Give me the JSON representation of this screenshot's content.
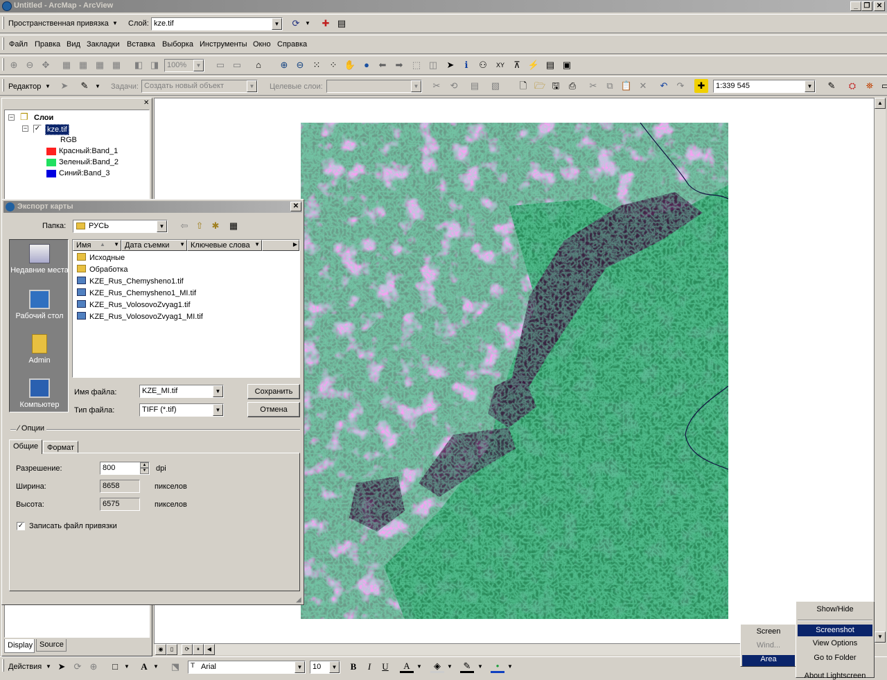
{
  "window": {
    "title": "Untitled - ArcMap - ArcView"
  },
  "georef_toolbar": {
    "label": "Пространственная привязка",
    "layer_label": "Слой:",
    "layer_value": "kze.tif"
  },
  "menu": [
    "Файл",
    "Правка",
    "Вид",
    "Закладки",
    "Вставка",
    "Выборка",
    "Инструменты",
    "Окно",
    "Справка"
  ],
  "tools_toolbar": {
    "zoom_value": "100%"
  },
  "editor_toolbar": {
    "editor_label": "Редактор",
    "task_label": "Задачи:",
    "task_value": "Создать новый объект",
    "target_label": "Целевые слои:",
    "target_value": "",
    "scale_value": "1:339 545"
  },
  "toc": {
    "root": "Слои",
    "layer": "kze.tif",
    "rgb": "RGB",
    "bands": [
      {
        "label": "Красный:Band_1",
        "color": "#ff2020"
      },
      {
        "label": "Зеленый:Band_2",
        "color": "#20e060"
      },
      {
        "label": "Синий:Band_3",
        "color": "#0000e0"
      }
    ],
    "tabs": [
      "Display",
      "Source"
    ]
  },
  "dialog": {
    "title": "Экспорт карты",
    "folder_label": "Папка:",
    "folder_value": "РУСЬ",
    "places": [
      "Недавние места",
      "Рабочий стол",
      "Admin",
      "Компьютер"
    ],
    "columns": [
      "Имя",
      "Дата съемки",
      "Ключевые слова"
    ],
    "files": [
      {
        "name": "Исходные",
        "type": "folder"
      },
      {
        "name": "Обработка",
        "type": "folder"
      },
      {
        "name": "KZE_Rus_Chemysheno1.tif",
        "type": "image"
      },
      {
        "name": "KZE_Rus_Chemysheno1_MI.tif",
        "type": "image"
      },
      {
        "name": "KZE_Rus_VolosovoZvyag1.tif",
        "type": "image"
      },
      {
        "name": "KZE_Rus_VolosovoZvyag1_MI.tif",
        "type": "image"
      }
    ],
    "filename_label": "Имя файла:",
    "filename_value": "KZE_MI.tif",
    "filetype_label": "Тип файла:",
    "filetype_value": "TIFF (*.tif)",
    "save_button": "Сохранить",
    "cancel_button": "Отмена",
    "options_label": "Опции",
    "tabs": [
      "Общие",
      "Формат"
    ],
    "resolution_label": "Разрешение:",
    "resolution_value": "800",
    "resolution_unit": "dpi",
    "width_label": "Ширина:",
    "width_value": "8658",
    "width_unit": "пикселов",
    "height_label": "Высота:",
    "height_value": "6575",
    "height_unit": "пикселов",
    "worldfile_label": "Записать файл привязки"
  },
  "draw_toolbar": {
    "actions_label": "Действия",
    "font_value": "Arial",
    "size_value": "10"
  },
  "overlay": {
    "screen_label": "Screen",
    "window_label": "Wind...",
    "area_label": "Area",
    "menu_items": [
      "Show/Hide",
      "Screenshot",
      "View Options",
      "Go to Folder",
      "About Lightscreen"
    ]
  }
}
